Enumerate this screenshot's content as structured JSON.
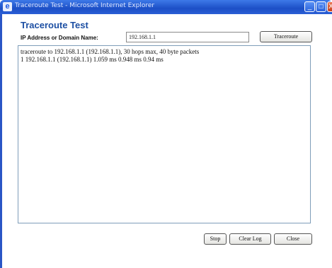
{
  "window": {
    "title": "Traceroute Test - Microsoft Internet Explorer",
    "app_icon": "ie-icon",
    "controls": {
      "minimize": "_",
      "maximize": "□",
      "close": "X"
    }
  },
  "page": {
    "title": "Traceroute Test",
    "ip_label": "IP Address or Domain Name:",
    "ip_value": "192.168.1.1",
    "traceroute_button": "Traceroute"
  },
  "log": {
    "lines": [
      "traceroute to 192.168.1.1 (192.168.1.1), 30 hops max, 40 byte packets",
      "1 192.168.1.1 (192.168.1.1) 1.059 ms 0.948 ms 0.94 ms"
    ]
  },
  "buttons": {
    "stop": "Stop",
    "clear_log": "Clear Log",
    "close": "Close"
  },
  "colors": {
    "title_blue": "#1d4fa3",
    "titlebar": "#2a56c6"
  }
}
